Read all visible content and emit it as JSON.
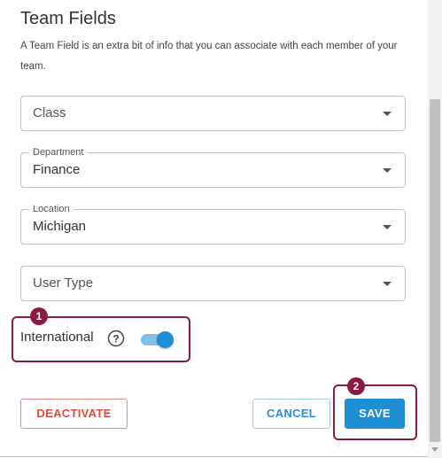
{
  "header": {
    "title": "Team Fields",
    "description": "A Team Field is an extra bit of info that you can associate with each member of your team."
  },
  "fields": {
    "class": {
      "placeholder": "Class",
      "icon": "chevron-down-icon"
    },
    "department": {
      "label": "Department",
      "value": "Finance",
      "icon": "chevron-down-icon"
    },
    "location": {
      "label": "Location",
      "value": "Michigan",
      "icon": "chevron-down-icon"
    },
    "user_type": {
      "placeholder": "User Type",
      "icon": "chevron-down-icon"
    }
  },
  "international": {
    "label": "International",
    "help_icon": "question-circle-icon",
    "enabled": true
  },
  "annotations": {
    "step1": "1",
    "step2": "2",
    "color": "#8b1c3f"
  },
  "buttons": {
    "deactivate": "DEACTIVATE",
    "cancel": "CANCEL",
    "save": "SAVE"
  },
  "colors": {
    "primary": "#1e8fd6",
    "danger": "#e0493a",
    "toggle_track": "#7fc0e8"
  }
}
